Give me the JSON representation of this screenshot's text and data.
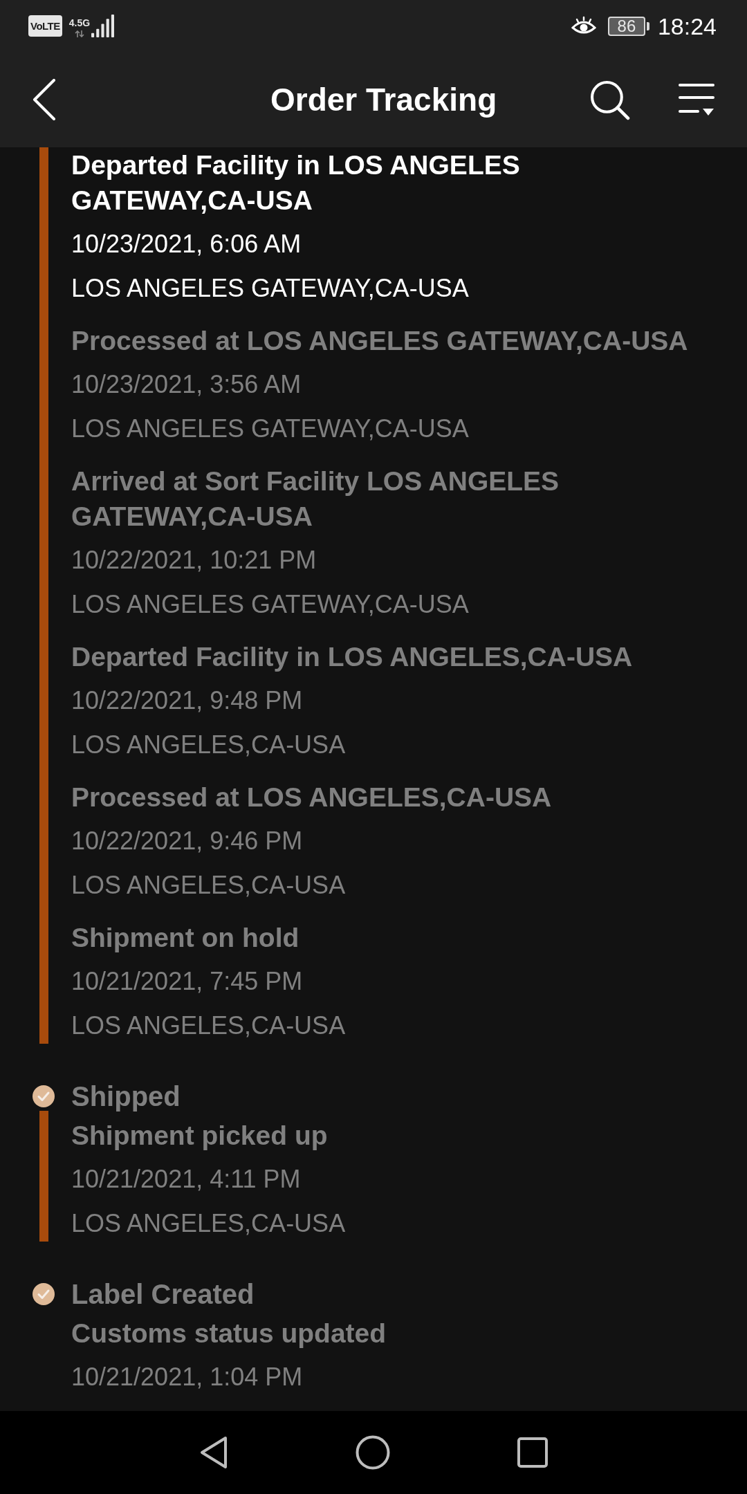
{
  "status_bar": {
    "volte_badge": "VoLTE",
    "network_type": "4.5G",
    "battery": "86",
    "time": "18:24"
  },
  "header": {
    "title": "Order Tracking"
  },
  "timeline": [
    {
      "events": [
        {
          "title": "Departed Facility in LOS ANGELES GATEWAY,CA-USA",
          "date": "10/23/2021, 6:06 AM",
          "location": "LOS ANGELES GATEWAY,CA-USA",
          "highlighted": true
        },
        {
          "title": "Processed at LOS ANGELES GATEWAY,CA-USA",
          "date": "10/23/2021, 3:56 AM",
          "location": "LOS ANGELES GATEWAY,CA-USA",
          "highlighted": false
        },
        {
          "title": "Arrived at Sort Facility LOS ANGELES GATEWAY,CA-USA",
          "date": "10/22/2021, 10:21 PM",
          "location": "LOS ANGELES GATEWAY,CA-USA",
          "highlighted": false
        },
        {
          "title": "Departed Facility in LOS ANGELES,CA-USA",
          "date": "10/22/2021, 9:48 PM",
          "location": "LOS ANGELES,CA-USA",
          "highlighted": false
        },
        {
          "title": "Processed at LOS ANGELES,CA-USA",
          "date": "10/22/2021, 9:46 PM",
          "location": "LOS ANGELES,CA-USA",
          "highlighted": false
        },
        {
          "title": "Shipment on hold",
          "date": "10/21/2021, 7:45 PM",
          "location": "LOS ANGELES,CA-USA",
          "highlighted": false
        }
      ]
    },
    {
      "label": "Shipped",
      "events": [
        {
          "title": "Shipment picked up",
          "date": "10/21/2021, 4:11 PM",
          "location": "LOS ANGELES,CA-USA",
          "highlighted": false
        }
      ]
    },
    {
      "label": "Label Created",
      "events": [
        {
          "title": "Customs status updated",
          "date": "10/21/2021, 1:04 PM",
          "highlighted": false
        }
      ]
    }
  ]
}
